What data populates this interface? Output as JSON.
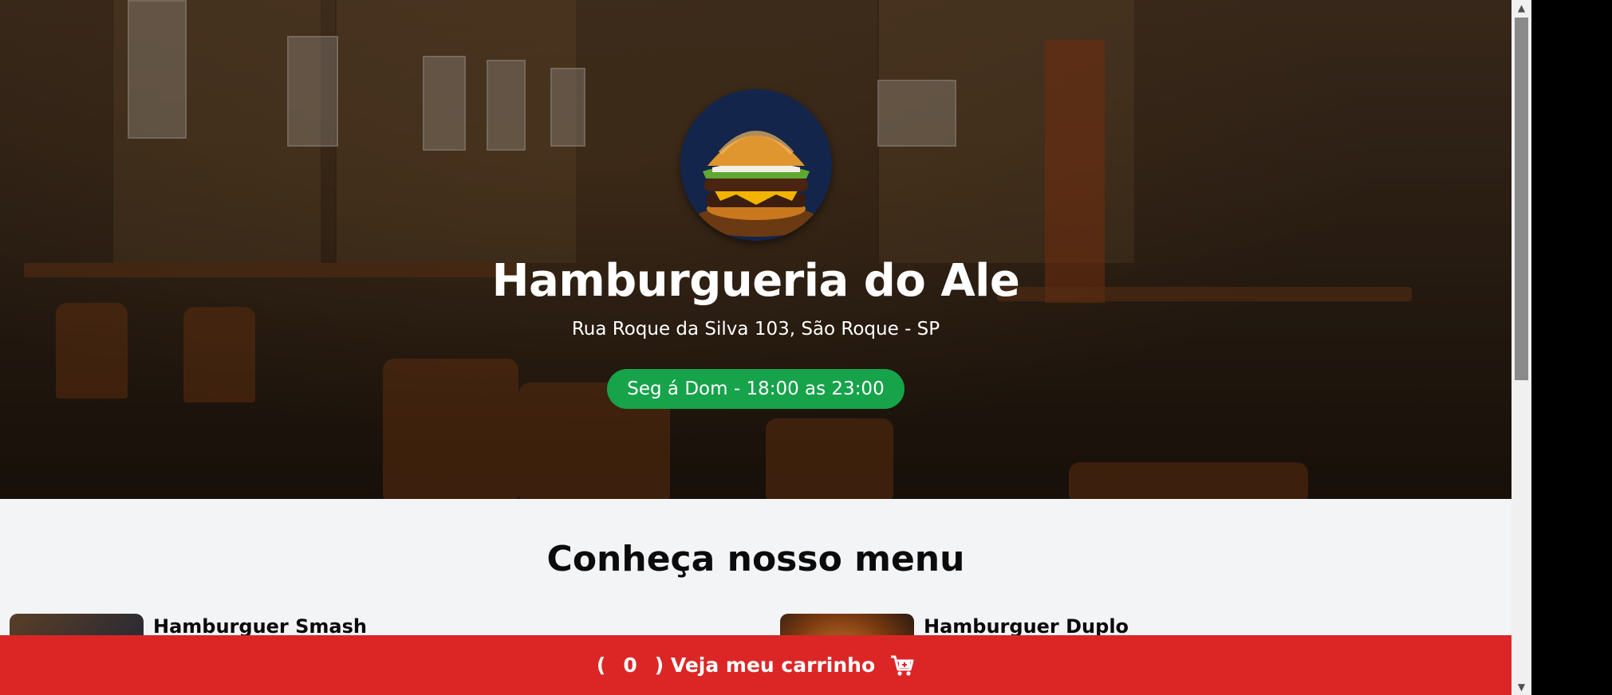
{
  "hero": {
    "title": "Hamburgueria do Ale",
    "address": "Rua Roque da Silva 103, São Roque - SP",
    "hours": "Seg á Dom - 18:00 as 23:00",
    "logo_icon": "burger-logo-icon"
  },
  "menu": {
    "title": "Conheça nosso menu",
    "items": [
      {
        "name": "Hamburguer Smash"
      },
      {
        "name": "Hamburguer Duplo"
      }
    ]
  },
  "cart": {
    "open_paren": "(",
    "count": "0",
    "close_label": ") Veja meu carrinho",
    "icon": "cart-icon"
  },
  "colors": {
    "accent_green": "#16a34a",
    "cart_red": "#dc2626"
  }
}
